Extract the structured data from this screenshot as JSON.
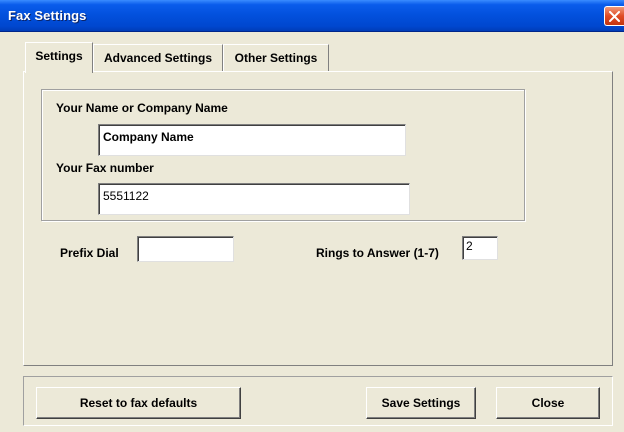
{
  "window": {
    "title": "Fax Settings"
  },
  "tabs": [
    {
      "label": "Settings",
      "active": true
    },
    {
      "label": "Advanced Settings",
      "active": false
    },
    {
      "label": "Other Settings",
      "active": false
    }
  ],
  "settings": {
    "name_label": "Your Name or Company Name",
    "name_value": "Company Name",
    "fax_label": "Your Fax number",
    "fax_value": "5551122",
    "prefix_label": "Prefix Dial",
    "prefix_value": "",
    "rings_label": "Rings to Answer (1-7)",
    "rings_value": "2"
  },
  "buttons": {
    "reset": "Reset to fax defaults",
    "save": "Save Settings",
    "close": "Close"
  },
  "colors": {
    "titlebar": "#0250DC",
    "window_bg": "#ECE9D8",
    "close_button": "#E04B25"
  },
  "icons": {
    "close": "close-icon"
  }
}
